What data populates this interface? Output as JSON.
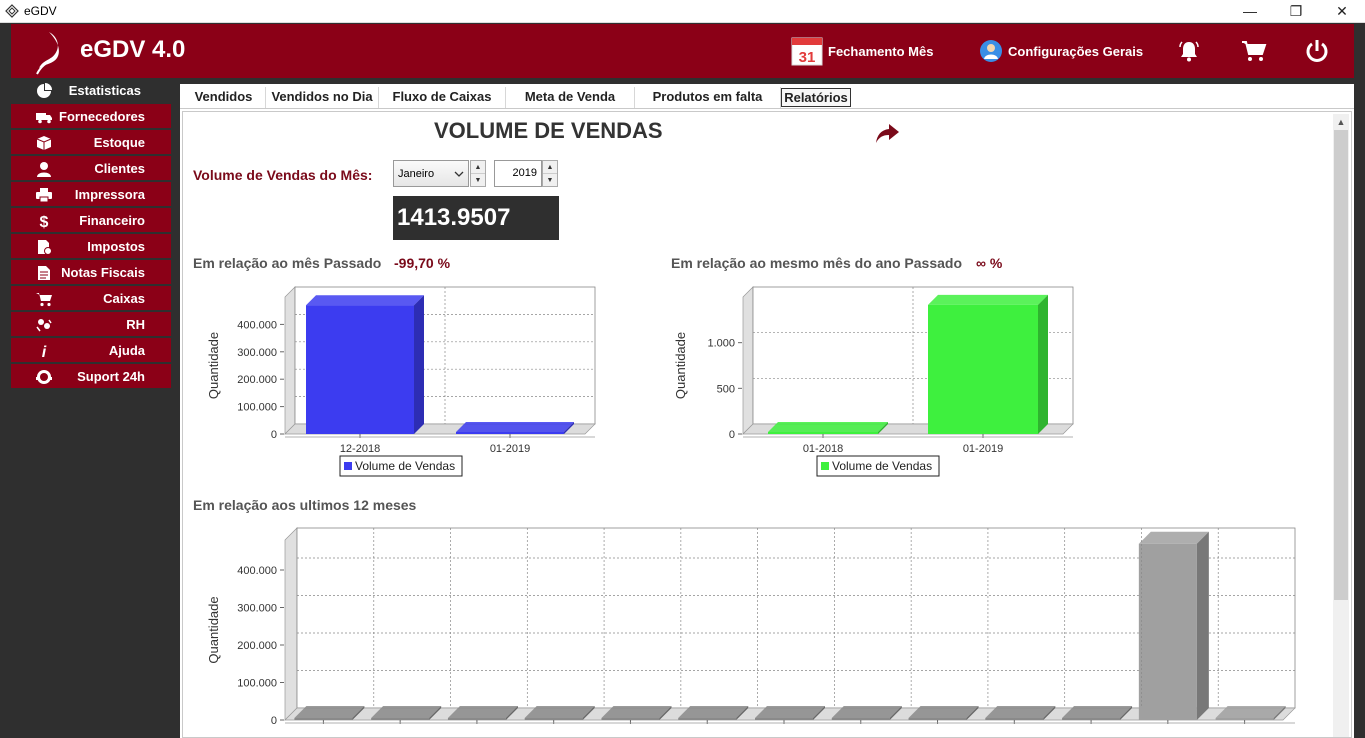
{
  "window": {
    "title": "eGDV",
    "minimize": "—",
    "maximize": "❐",
    "close": "✕"
  },
  "header": {
    "app_name": "eGDV 4.0",
    "calendar_day": "31",
    "fechamento_label": "Fechamento Mês",
    "config_label": "Configurações Gerais"
  },
  "sidebar": {
    "items": [
      {
        "label": "Estatisticas",
        "icon": "pie-chart-icon"
      },
      {
        "label": "Fornecedores",
        "icon": "truck-icon"
      },
      {
        "label": "Estoque",
        "icon": "box-icon"
      },
      {
        "label": "Clientes",
        "icon": "user-icon"
      },
      {
        "label": "Impressora",
        "icon": "printer-icon"
      },
      {
        "label": "Financeiro",
        "icon": "dollar-icon"
      },
      {
        "label": "Impostos",
        "icon": "tax-document-icon"
      },
      {
        "label": "Notas Fiscais",
        "icon": "invoice-icon"
      },
      {
        "label": "Caixas",
        "icon": "cart-icon"
      },
      {
        "label": "RH",
        "icon": "people-icon"
      },
      {
        "label": "Ajuda",
        "icon": "info-icon"
      },
      {
        "label": "Suport 24h",
        "icon": "support-icon"
      }
    ]
  },
  "tabs": [
    "Vendidos",
    "Vendidos no Dia",
    "Fluxo de Caixas",
    "Meta de Venda",
    "Produtos em falta",
    "Relatórios"
  ],
  "report": {
    "title": "VOLUME DE VENDAS",
    "month_label": "Volume de Vendas do Mês:",
    "month_value": "Janeiro",
    "year_value": "2019",
    "total_value": "1413.9507",
    "prev_month_label": "Em relação ao mês Passado",
    "prev_month_pct": "-99,70 %",
    "prev_year_label": "Em relação ao mesmo mês do ano Passado",
    "prev_year_pct": "∞ %",
    "last12_label": "Em relação aos ultimos 12 meses"
  },
  "colors": {
    "brand": "#8b0017",
    "blue": "#3c3cf0",
    "green": "#3ef03e",
    "gray": "#a0a0a0"
  },
  "chart_data": [
    {
      "type": "bar",
      "categories": [
        "12-2018",
        "01-2019"
      ],
      "series": [
        {
          "name": "Volume de Vendas",
          "values": [
            470000,
            1413.9507
          ]
        }
      ],
      "ylabel": "Quantidade",
      "yticks": [
        "0",
        "100.000",
        "200.000",
        "300.000",
        "400.000"
      ],
      "ylim": [
        0,
        500000
      ],
      "legend": "bottom-center",
      "grid": true
    },
    {
      "type": "bar",
      "categories": [
        "01-2018",
        "01-2019"
      ],
      "series": [
        {
          "name": "Volume de Vendas",
          "values": [
            0,
            1413.9507
          ]
        }
      ],
      "ylabel": "Quantidade",
      "yticks": [
        "0",
        "500",
        "1.000"
      ],
      "ylim": [
        0,
        1500
      ],
      "legend": "bottom-center",
      "grid": true
    },
    {
      "type": "bar",
      "categories": [
        "",
        "",
        "",
        "",
        "",
        "",
        "",
        "",
        "",
        "",
        "",
        "",
        ""
      ],
      "series": [
        {
          "name": "",
          "values": [
            0,
            0,
            0,
            0,
            0,
            0,
            0,
            0,
            0,
            0,
            0,
            470000,
            1413.9507
          ]
        }
      ],
      "ylabel": "Quantidade",
      "yticks": [
        "0",
        "100.000",
        "200.000",
        "300.000",
        "400.000"
      ],
      "ylim": [
        0,
        480000
      ],
      "grid": true
    }
  ]
}
